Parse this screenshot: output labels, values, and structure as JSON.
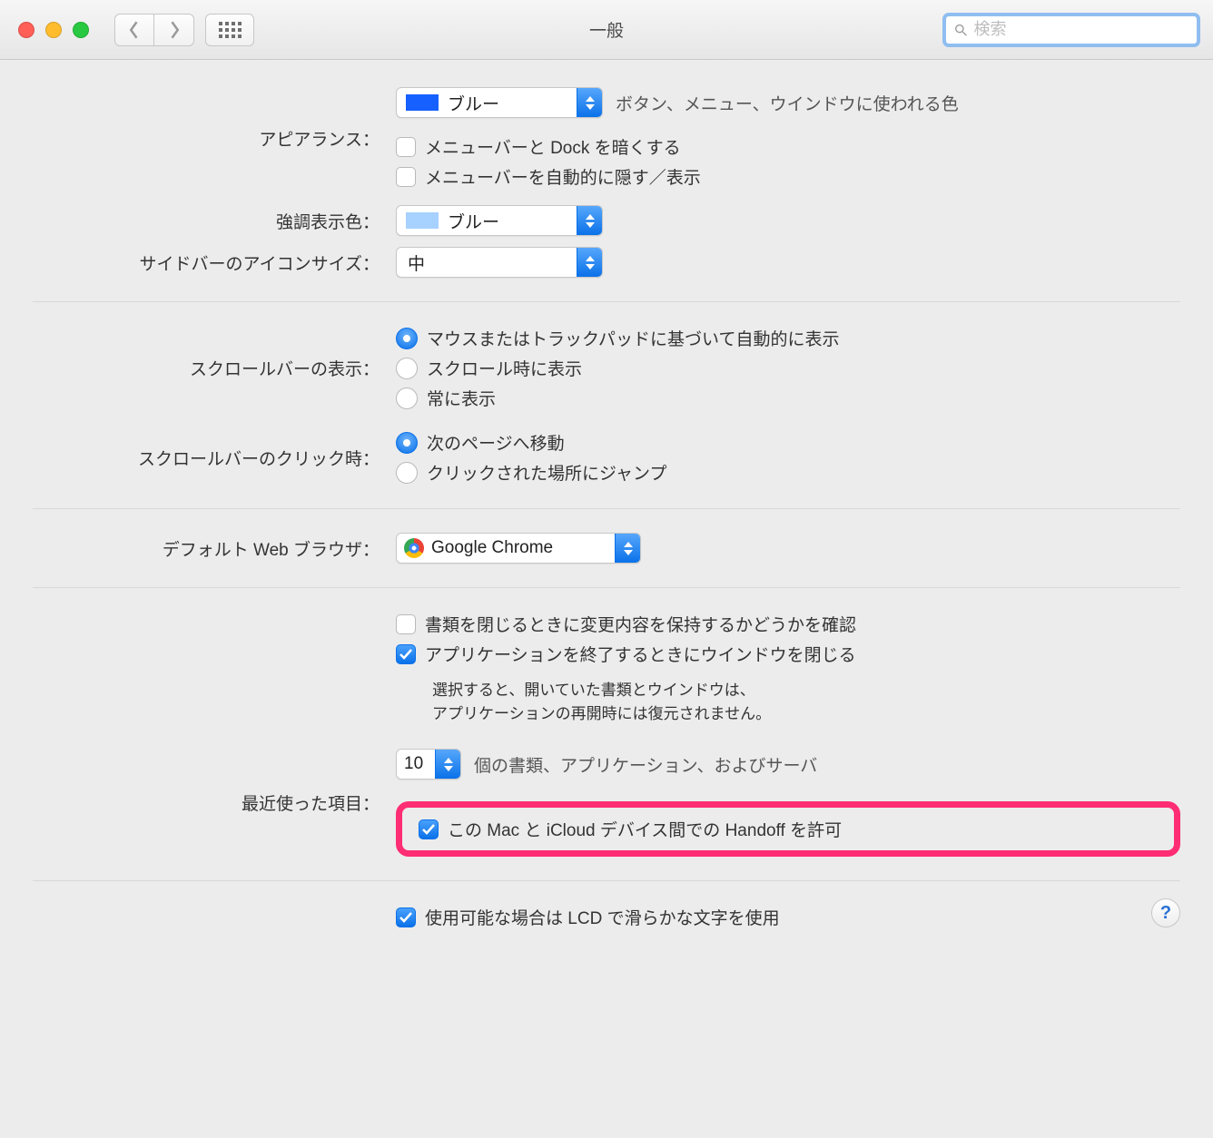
{
  "window_title": "一般",
  "search_placeholder": "検索",
  "labels": {
    "appearance": "アピアランス：",
    "highlight": "強調表示色：",
    "sidebar_icon": "サイドバーのアイコンサイズ：",
    "scrollbar_show": "スクロールバーの表示：",
    "scrollbar_click": "スクロールバーのクリック時：",
    "default_browser": "デフォルト Web ブラウザ：",
    "recent_items": "最近使った項目："
  },
  "appearance": {
    "value": "ブルー",
    "swatch": "#1560ff",
    "note": "ボタン、メニュー、ウインドウに使われる色",
    "ck_darkmenu": "メニューバーと Dock を暗くする",
    "ck_autohide": "メニューバーを自動的に隠す／表示"
  },
  "highlight": {
    "value": "ブルー",
    "swatch": "#a7d1ff"
  },
  "sidebar": {
    "value": "中"
  },
  "scroll_show": {
    "opt_auto": "マウスまたはトラックパッドに基づいて自動的に表示",
    "opt_when": "スクロール時に表示",
    "opt_always": "常に表示"
  },
  "scroll_click": {
    "opt_next": "次のページへ移動",
    "opt_jump": "クリックされた場所にジャンプ"
  },
  "browser": {
    "value": "Google Chrome"
  },
  "documents": {
    "ck_ask_changes": "書類を閉じるときに変更内容を保持するかどうかを確認",
    "ck_close_windows": "アプリケーションを終了するときにウインドウを閉じる",
    "desc1": "選択すると、開いていた書類とウインドウは、",
    "desc2": "アプリケーションの再開時には復元されません。"
  },
  "recent": {
    "value": "10",
    "suffix": "個の書類、アプリケーション、およびサーバ",
    "ck_handoff": "この Mac と iCloud デバイス間での Handoff を許可"
  },
  "lcd": {
    "ck_lcd": "使用可能な場合は LCD で滑らかな文字を使用"
  }
}
